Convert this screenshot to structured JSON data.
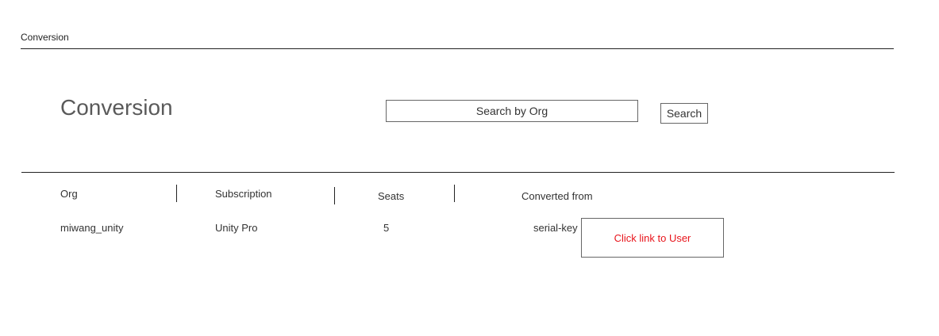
{
  "breadcrumb": {
    "label": "Conversion"
  },
  "page": {
    "title": "Conversion"
  },
  "search": {
    "placeholder": "Search by Org",
    "button_label": "Search"
  },
  "table": {
    "headers": {
      "org": "Org",
      "subscription": "Subscription",
      "seats": "Seats",
      "converted_from": "Converted from"
    },
    "rows": [
      {
        "org": "miwang_unity",
        "subscription": "Unity Pro",
        "seats": "5",
        "converted_from": "serial-key",
        "link_label": "Click link to User"
      }
    ]
  },
  "colors": {
    "link": "#e8141b",
    "rule": "#222222",
    "title": "#5a5a5a"
  }
}
